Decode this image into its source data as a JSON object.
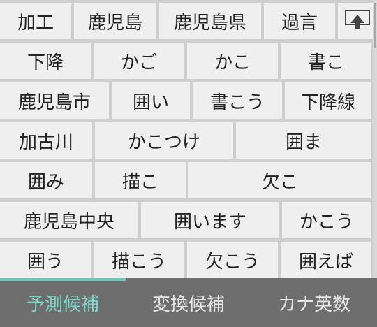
{
  "rows": [
    [
      "加工",
      "鹿児島",
      "鹿児島県",
      "過言"
    ],
    [
      "下降",
      "かご",
      "かこ",
      "書こ"
    ],
    [
      "鹿児島市",
      "囲い",
      "書こう",
      "下降線"
    ],
    [
      "加古川",
      "かこつけ",
      "囲ま"
    ],
    [
      "囲み",
      "描こ",
      "欠こ"
    ],
    [
      "鹿児島中央",
      "囲います",
      "かこう"
    ],
    [
      "囲う",
      "描こう",
      "欠こう",
      "囲えば"
    ]
  ],
  "expand_icon": "keyboard-collapse-icon",
  "tabs": {
    "prediction": "予測候補",
    "conversion": "変換候補",
    "kana_alnum": "カナ英数"
  },
  "colors": {
    "accent": "#6fc5b9",
    "key_bg": "#efefef",
    "tabbar_bg": "#6e6e6e"
  }
}
